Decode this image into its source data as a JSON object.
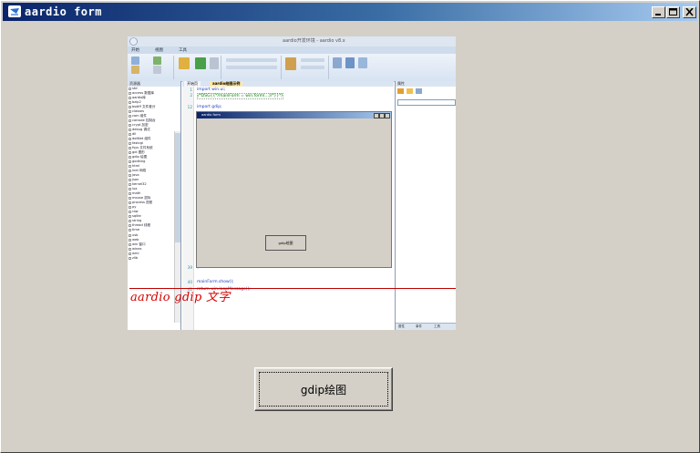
{
  "window": {
    "title": "aardio form",
    "icon": "aardio-logo-icon",
    "controls": [
      "minimize-icon",
      "maximize-icon",
      "close-icon"
    ]
  },
  "embedded_screenshot": {
    "ide_title": "aardio开发环境 - aardio v8.x",
    "menu_tabs": [
      "开始",
      "视图",
      "工具"
    ],
    "left_panel_title": "资源器",
    "tree_items": [
      "std",
      "access 数据库",
      "aardio库",
      "bzip2",
      "bsdiff 文件差分",
      "classes",
      "com 组件",
      "console 控制台",
      "crypt 加密",
      "debug 调试",
      "dll",
      "dotNet 组件",
      "fastcgi",
      "fsys 文件系统",
      "gdi 图形",
      "gdip 绘图",
      "godking",
      "html",
      "inet 网络",
      "java",
      "json",
      "kernel32",
      "lua",
      "math",
      "mouse 鼠标",
      "process 进程",
      "py",
      "raw",
      "sqlite",
      "string",
      "thread 线程",
      "time",
      "usb",
      "web",
      "win 窗口",
      "winex",
      "wmi",
      "zlib"
    ],
    "left_tabs": [
      "资源",
      "工程",
      "库"
    ],
    "doc_tabs": [
      "开始页",
      "aardio绘图示例"
    ],
    "code_lines": [
      {
        "n": "1",
        "text": "import win.ui;"
      },
      {
        "n": "2",
        "text": "/*DSG{{*/mainForm = win.form(...)/*}}*/"
      },
      {
        "n": "12",
        "text": "import gdip;"
      },
      {
        "n": "39",
        "text": "}"
      },
      {
        "n": "40",
        "text": "mainForm.show();"
      },
      {
        "n": "41",
        "text": "return win.loopMessage();"
      }
    ],
    "mini_window_title": "aardio form",
    "mini_button_label": "gdip绘图",
    "right_panel_title": "属性",
    "right_tabs": [
      "属性",
      "事件",
      "工具"
    ]
  },
  "overlay_text": "aardio gdip 文字",
  "overlay_color": "#d40000",
  "button": {
    "label": "gdip绘图"
  }
}
